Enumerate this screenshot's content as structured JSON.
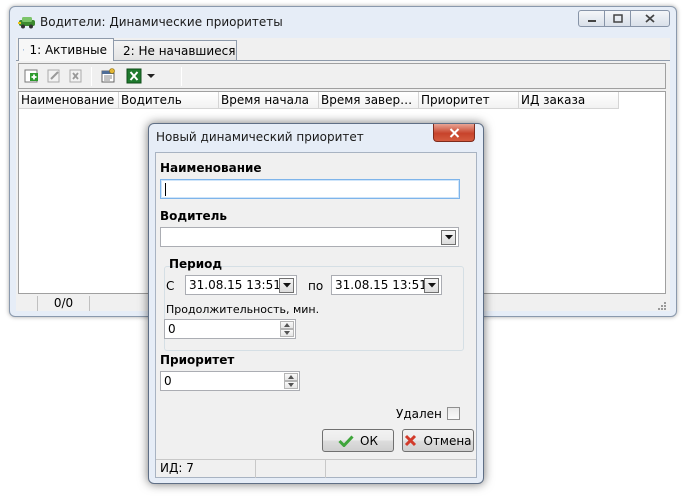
{
  "main_window": {
    "title": "Водители: Динамические приоритеты",
    "tabs": [
      {
        "label": "1: Активные",
        "active": true
      },
      {
        "label": "2: Не начавшиеся",
        "active": false
      }
    ],
    "grid_columns": [
      "Наименование",
      "Водитель",
      "Время начала",
      "Время завершен...",
      "Приоритет",
      "ИД заказа"
    ],
    "status": {
      "count": "0/0"
    }
  },
  "dialog": {
    "title": "Новый динамический приоритет",
    "name_label": "Наименование",
    "name_value": "",
    "driver_label": "Водитель",
    "driver_value": "",
    "period": {
      "label": "Период",
      "from_label": "С",
      "from_value": "31.08.15 13:51",
      "to_label": "по",
      "to_value": "31.08.15 13:51",
      "duration_label": "Продолжительность, мин.",
      "duration_value": "0"
    },
    "priority_label": "Приоритет",
    "priority_value": "0",
    "deleted_label": "Удален",
    "deleted_checked": false,
    "ok_label": "ОК",
    "cancel_label": "Отмена",
    "status_id": "ИД: 7"
  },
  "colors": {
    "frame": "#e6edf7",
    "close_red": "#c7432b",
    "excel_green": "#1f7a2e"
  }
}
